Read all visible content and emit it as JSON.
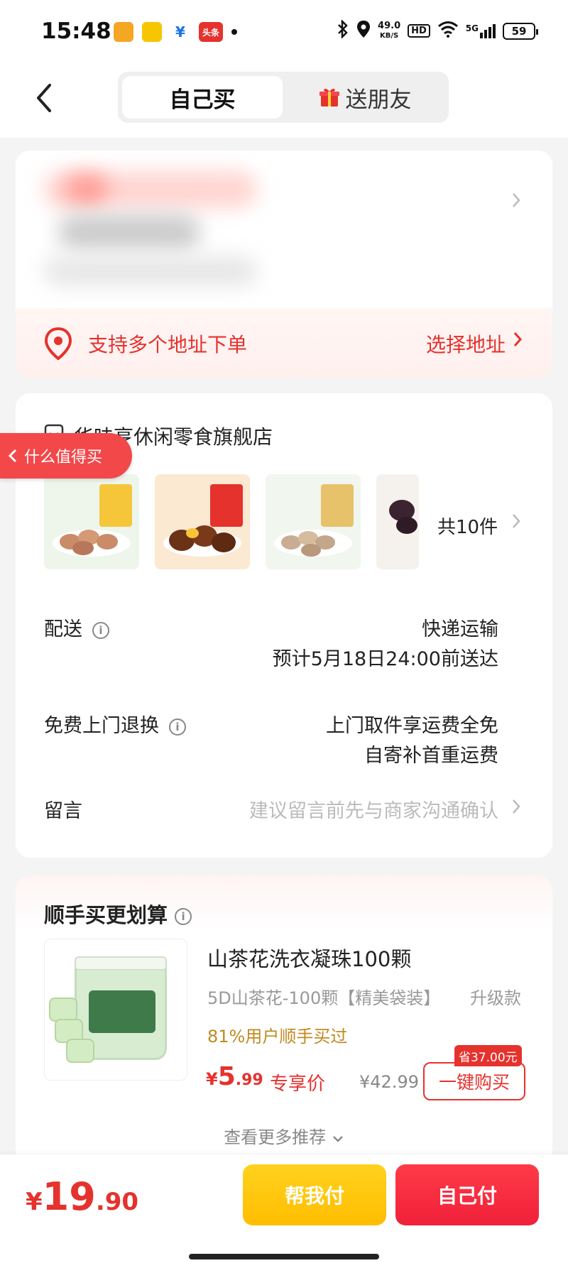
{
  "status_bar": {
    "time": "15:48",
    "net_speed": "49.0",
    "net_unit": "KB/S",
    "hd": "HD",
    "network": "5G",
    "battery": "59",
    "app_icons": [
      "news-app-icon",
      "taxi-app-icon",
      "payment-app-icon",
      "toutiao-app-icon"
    ],
    "toutiao_label": "头条"
  },
  "header": {
    "tab_self": "自己买",
    "tab_gift": "送朋友"
  },
  "address": {
    "multi_label": "支持多个地址下单",
    "select_label": "选择地址"
  },
  "store": {
    "name": "华味亨休闲零食旗舰店",
    "float_tag": "什么值得买",
    "item_count": "共10件"
  },
  "delivery": {
    "label": "配送",
    "method": "快递运输",
    "eta": "预计5月18日24:00前送达"
  },
  "returns": {
    "label": "免费上门退换",
    "line1": "上门取件享运费全免",
    "line2": "自寄补首重运费"
  },
  "message": {
    "label": "留言",
    "placeholder": "建议留言前先与商家沟通确认"
  },
  "recommend": {
    "title": "顺手买更划算",
    "name": "山茶花洗衣凝珠100颗",
    "spec": "5D山茶花-100颗【精美袋装】",
    "spec2": "升级款",
    "bought_pct": "81%用户顺手买过",
    "price_cur": "¥",
    "price_int": "5",
    "price_dec": ".99",
    "exclusive": "专享价",
    "orig_price": "¥42.99",
    "save_badge": "省37.00元",
    "buy_label": "一键购买",
    "more": "查看更多推荐"
  },
  "bottom": {
    "cur": "¥",
    "int": "19",
    "dec": ".90",
    "help_pay": "帮我付",
    "self_pay": "自己付"
  },
  "colors": {
    "accent_red": "#e5322d",
    "yellow_button": "#ffbd00",
    "red_button": "#f0203a"
  }
}
